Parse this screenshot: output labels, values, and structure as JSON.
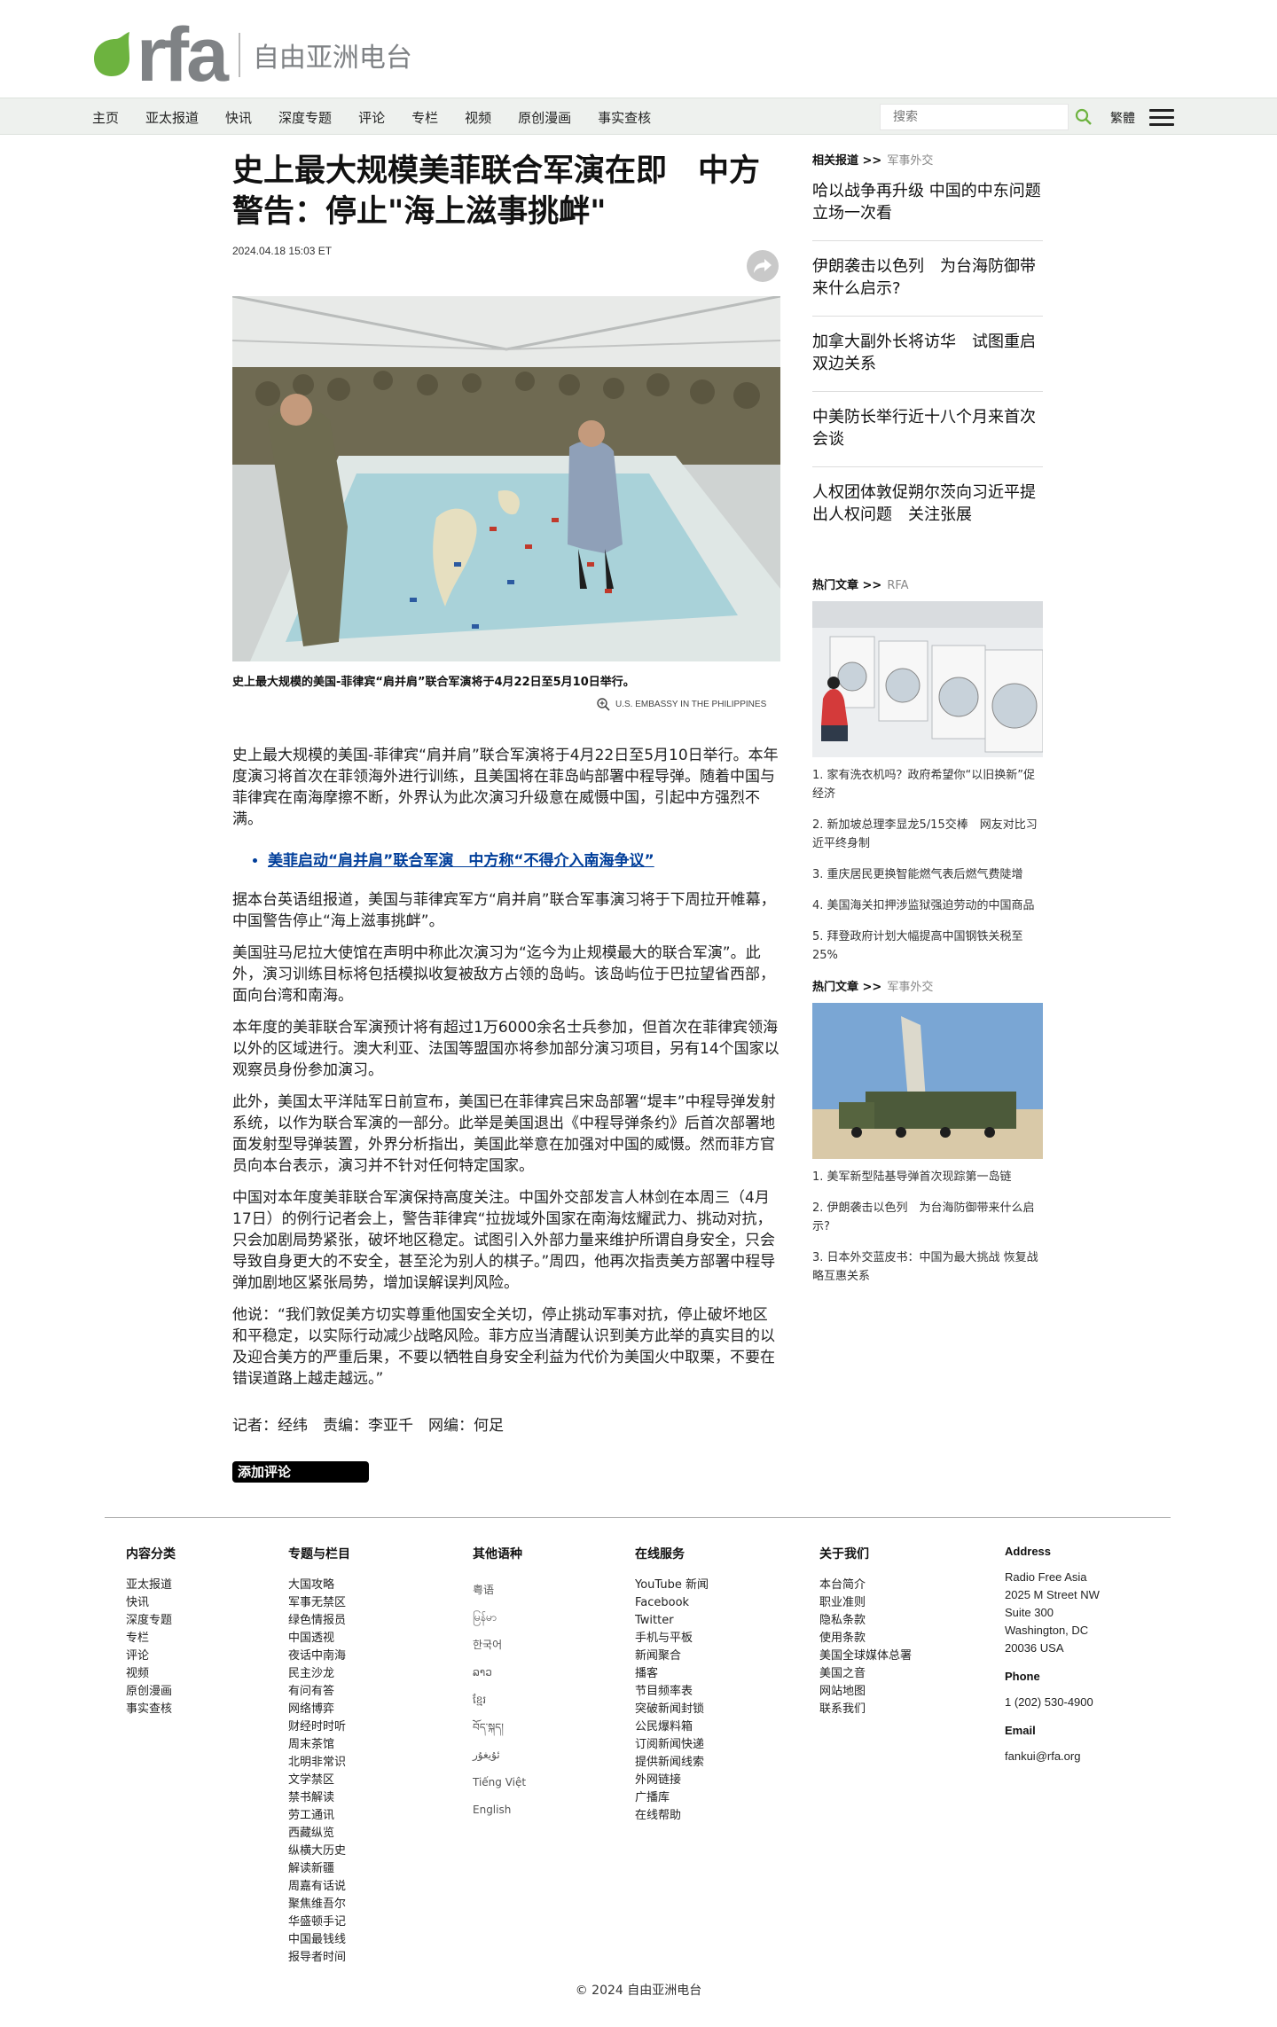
{
  "header": {
    "logo_text": "rfa",
    "logo_cn": "自由亚洲电台",
    "nav": [
      "主页",
      "亚太报道",
      "快讯",
      "深度专题",
      "评论",
      "专栏",
      "视频",
      "原创漫画",
      "事实查核"
    ],
    "search_placeholder": "搜索",
    "lang_switch": "繁體"
  },
  "article": {
    "headline": "史上最大规模美菲联合军演在即　中方警告：停止\"海上滋事挑衅\"",
    "date": "2024.04.18 15:03 ET",
    "caption": "史上最大规模的美国-菲律宾“肩并肩”联合军演将于4月22日至5月10日举行。",
    "credit": "U.S. EMBASSY IN THE PHILIPPINES",
    "intro": "史上最大规模的美国-菲律宾“肩并肩”联合军演将于4月22日至5月10日举行。本年度演习将首次在菲领海外进行训练，且美国将在菲岛屿部署中程导弹。随着中国与菲律宾在南海摩擦不断，外界认为此次演习升级意在威慑中国，引起中方强烈不满。",
    "related_link": "美菲启动“肩并肩”联合军演　中方称“不得介入南海争议”",
    "paragraphs": [
      "据本台英语组报道，美国与菲律宾军方“肩并肩”联合军事演习将于下周拉开帷幕，中国警告停止“海上滋事挑衅”。",
      "美国驻马尼拉大使馆在声明中称此次演习为“迄今为止规模最大的联合军演”。此外，演习训练目标将包括模拟收复被敌方占领的岛屿。该岛屿位于巴拉望省西部，面向台湾和南海。",
      "本年度的美菲联合军演预计将有超过1万6000余名士兵参加，但首次在菲律宾领海以外的区域进行。澳大利亚、法国等盟国亦将参加部分演习项目，另有14个国家以观察员身份参加演习。",
      "此外，美国太平洋陆军日前宣布，美国已在菲律宾吕宋岛部署“堤丰”中程导弹发射系统，以作为联合军演的一部分。此举是美国退出《中程导弹条约》后首次部署地面发射型导弹装置，外界分析指出，美国此举意在加强对中国的威慑。然而菲方官员向本台表示，演习并不针对任何特定国家。",
      "中国对本年度美菲联合军演保持高度关注。中国外交部发言人林剑在本周三（4月17日）的例行记者会上，警告菲律宾“拉拢域外国家在南海炫耀武力、挑动对抗，只会加剧局势紧张，破坏地区稳定。试图引入外部力量来维护所谓自身安全，只会导致自身更大的不安全，甚至沦为别人的棋子。”周四，他再次指责美方部署中程导弹加剧地区紧张局势，增加误解误判风险。",
      "他说：“我们敦促美方切实尊重他国安全关切，停止挑动军事对抗，停止破坏地区和平稳定，以实际行动减少战略风险。菲方应当清醒认识到美方此举的真实目的以及迎合美方的严重后果，不要以牺牲自身安全利益为代价为美国火中取栗，不要在错误道路上越走越远。”"
    ],
    "byline": "记者：经纬　责编：李亚千　网编：何足",
    "comment_button": "添加评论"
  },
  "sidebar": {
    "related_head": "相关报道 >>",
    "related_sub": "军事外交",
    "related": [
      "哈以战争再升级 中国的中东问题立场一次看",
      "伊朗袭击以色列　为台海防御带来什么启示?",
      "加拿大副外长将访华　试图重启双边关系",
      "中美防长举行近十八个月来首次会谈",
      "人权团体敦促朔尔茨向习近平提出人权问题　关注张展"
    ],
    "hot1_head": "热门文章 >>",
    "hot1_sub": "RFA",
    "hot1": [
      "1. 家有洗衣机吗？政府希望你“以旧换新”促经济",
      "2. 新加坡总理李显龙5/15交棒　网友对比习近平终身制",
      "3. 重庆居民更换智能燃气表后燃气费陡增",
      "4. 美国海关扣押涉监狱强迫劳动的中国商品",
      "5. 拜登政府计划大幅提高中国钢铁关税至25%"
    ],
    "hot2_head": "热门文章 >>",
    "hot2_sub": "军事外交",
    "hot2": [
      "1. 美军新型陆基导弹首次现踪第一岛链",
      "2. 伊朗袭击以色列　为台海防御带来什么启示?",
      "3. 日本外交蓝皮书：中国为最大挑战 恢复战略互惠关系"
    ]
  },
  "footer": {
    "col1_head": "内容分类",
    "col1": [
      "亚太报道",
      "快讯",
      "深度专题",
      "专栏",
      "评论",
      "视频",
      "原创漫画",
      "事实查核"
    ],
    "col2_head": "专题与栏目",
    "col2": [
      "大国攻略",
      "军事无禁区",
      "绿色情报员",
      "中国透视",
      "夜话中南海",
      "民主沙龙",
      "有问有答",
      "网络博弈",
      "财经时时听",
      "周末茶馆",
      "北明非常识",
      "文学禁区",
      "禁书解读",
      "劳工通讯",
      "西藏纵览",
      "纵横大历史",
      "解读新疆",
      "周嘉有话说",
      "聚焦维吾尔",
      "华盛顿手记",
      "中国最钱线",
      "报导者时间"
    ],
    "col3_head": "其他语种",
    "col3": [
      "粤语",
      "မြန်မာ",
      "한국어",
      "ລາວ",
      "ខ្មែរ",
      "བོད་སྐད།",
      "ئۇيغۇر",
      "Tiếng Việt",
      "English"
    ],
    "col4_head": "在线服务",
    "col4": [
      "YouTube 新闻",
      "Facebook",
      "Twitter",
      "手机与平板",
      "新闻聚合",
      "播客",
      "节目频率表",
      "突破新闻封锁",
      "公民爆料箱",
      "订阅新闻快递",
      "提供新闻线索",
      "外网链接",
      "广播库",
      "在线帮助"
    ],
    "col5_head": "关于我们",
    "col5": [
      "本台简介",
      "职业准则",
      "隐私条款",
      "使用条款",
      "美国全球媒体总署",
      "美国之音",
      "网站地图",
      "联系我们"
    ],
    "address_head": "Address",
    "address": [
      "Radio Free Asia",
      "2025 M Street NW",
      "Suite 300",
      "Washington, DC",
      "20036 USA"
    ],
    "phone_head": "Phone",
    "phone": "1 (202) 530-4900",
    "email_head": "Email",
    "email": "fankui@rfa.org",
    "copyright": "© 2024 自由亚洲电台"
  },
  "colors": {
    "brand_green": "#6db33f",
    "nav_bg": "#eef1ee",
    "link_blue": "#003e9a"
  },
  "icons": [
    "leaf-logo-icon",
    "search-icon",
    "share-icon",
    "hamburger-menu-icon",
    "magnify-plus-icon"
  ]
}
